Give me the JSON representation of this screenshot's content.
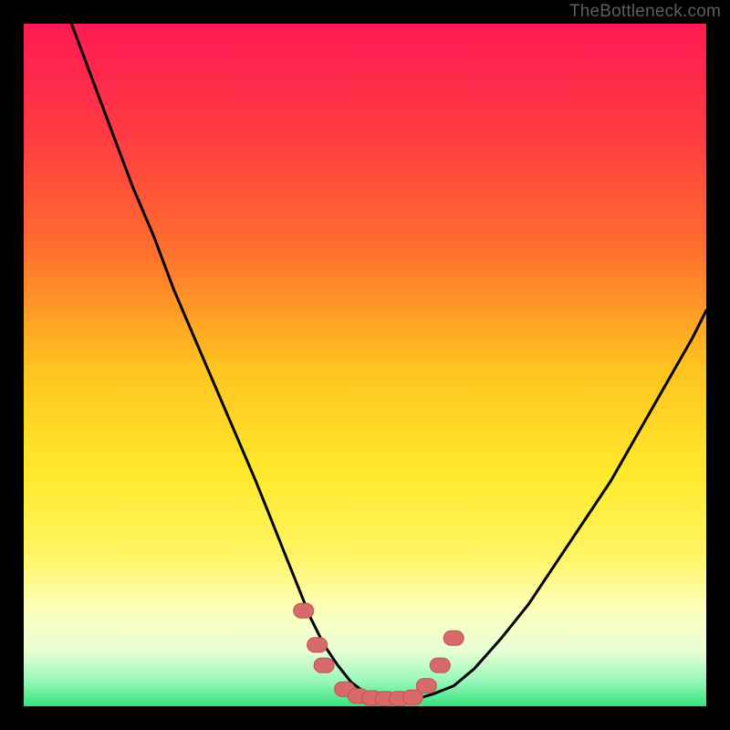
{
  "watermark": "TheBottleneck.com",
  "colors": {
    "frame": "#000000",
    "curve": "#000000",
    "marker_fill": "#d76b6b",
    "marker_stroke": "#c44f4f",
    "gradient_stops": [
      {
        "offset": 0.0,
        "color": "#ff1a54"
      },
      {
        "offset": 0.16,
        "color": "#ff3a42"
      },
      {
        "offset": 0.33,
        "color": "#ff6e2e"
      },
      {
        "offset": 0.5,
        "color": "#ffc21f"
      },
      {
        "offset": 0.66,
        "color": "#ffe92b"
      },
      {
        "offset": 0.78,
        "color": "#fff565"
      },
      {
        "offset": 0.86,
        "color": "#fdffbc"
      },
      {
        "offset": 0.92,
        "color": "#e7ffd6"
      },
      {
        "offset": 0.965,
        "color": "#93f7b8"
      },
      {
        "offset": 1.0,
        "color": "#37e27e"
      }
    ]
  },
  "chart_data": {
    "type": "line",
    "title": "",
    "xlabel": "",
    "ylabel": "",
    "xlim": [
      0,
      100
    ],
    "ylim": [
      0,
      100
    ],
    "series": [
      {
        "name": "bottleneck-curve",
        "x": [
          7,
          10,
          13,
          16,
          19,
          22,
          25,
          28,
          31,
          34,
          36,
          38,
          40,
          42,
          44,
          46,
          48,
          50,
          52,
          54,
          56,
          58,
          60,
          63,
          66,
          70,
          74,
          78,
          82,
          86,
          90,
          94,
          98,
          100
        ],
        "y": [
          100,
          92,
          84,
          76,
          69,
          61,
          54,
          47,
          40,
          33,
          28,
          23,
          18,
          13,
          9,
          6,
          3.5,
          2,
          1.3,
          1,
          1,
          1.2,
          1.8,
          3,
          5.5,
          10,
          15,
          21,
          27,
          33,
          40,
          47,
          54,
          58
        ]
      }
    ],
    "markers": [
      {
        "x": 41,
        "y": 14
      },
      {
        "x": 43,
        "y": 9
      },
      {
        "x": 44,
        "y": 6
      },
      {
        "x": 47,
        "y": 2.5
      },
      {
        "x": 49,
        "y": 1.5
      },
      {
        "x": 51,
        "y": 1.2
      },
      {
        "x": 53,
        "y": 1.1
      },
      {
        "x": 55,
        "y": 1.1
      },
      {
        "x": 57,
        "y": 1.3
      },
      {
        "x": 59,
        "y": 3
      },
      {
        "x": 61,
        "y": 6
      },
      {
        "x": 63,
        "y": 10
      }
    ]
  }
}
